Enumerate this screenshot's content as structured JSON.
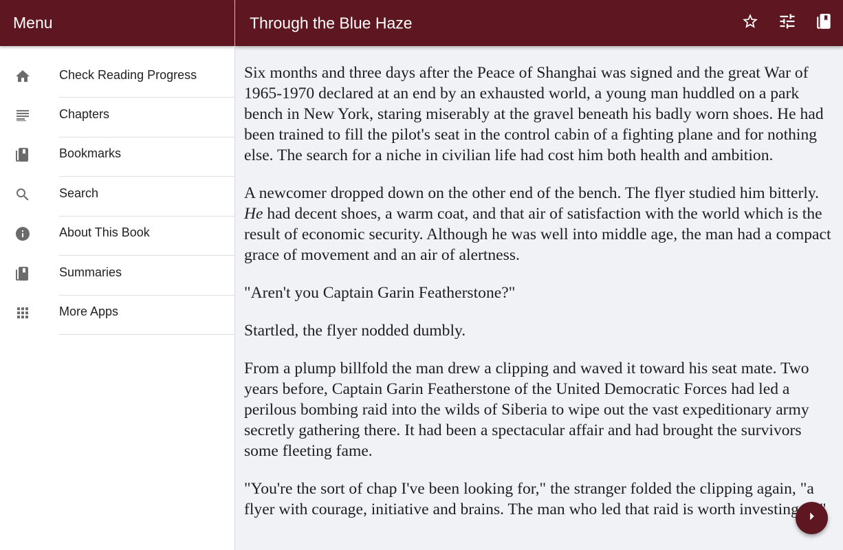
{
  "drawer": {
    "title": "Menu",
    "items": [
      {
        "label": "Check Reading Progress",
        "icon": "home-icon"
      },
      {
        "label": "Chapters",
        "icon": "list-icon"
      },
      {
        "label": "Bookmarks",
        "icon": "book-icon"
      },
      {
        "label": "Search",
        "icon": "search-icon"
      },
      {
        "label": "About This Book",
        "icon": "info-icon"
      },
      {
        "label": "Summaries",
        "icon": "book-icon"
      },
      {
        "label": "More Apps",
        "icon": "apps-grid-icon"
      }
    ]
  },
  "toolbar": {
    "title": "Through the Blue Haze",
    "actions": [
      "star-icon",
      "settings-sliders-icon",
      "book-icon"
    ]
  },
  "content": {
    "p1": "Six months and three days after the Peace of Shanghai was signed and the great War of 1965-1970 declared at an end by an exhausted world, a young man huddled on a park bench in New York, staring miserably at the gravel beneath his badly worn shoes. He had been trained to fill the pilot's seat in the control cabin of a fighting plane and for nothing else. The search for a niche in civilian life had cost him both health and ambition.",
    "p2_pre": "A newcomer dropped down on the other end of the bench. The flyer studied him bitterly. ",
    "p2_em": "He",
    "p2_post": " had decent shoes, a warm coat, and that air of satisfaction with the world which is the result of economic security. Although he was well into middle age, the man had a compact grace of movement and an air of alertness.",
    "p3": "\"Aren't you Captain Garin Featherstone?\"",
    "p4": "Startled, the flyer nodded dumbly.",
    "p5": "From a plump billfold the man drew a clipping and waved it toward his seat mate. Two years before, Captain Garin Featherstone of the United Democratic Forces had led a perilous bombing raid into the wilds of Siberia to wipe out the vast expeditionary army secretly gathering there. It had been a spectacular affair and had brought the survivors some fleeting fame.",
    "p6": "\"You're the sort of chap I've been looking for,\" the stranger folded the clipping again, \"a flyer with courage, initiative and brains. The man who led that raid is worth investing in.\""
  },
  "fab": {
    "icon": "chevron-right-icon"
  },
  "colors": {
    "primary": "#5e1720",
    "content_background": "#f1f2f6",
    "drawer_background": "#ffffff",
    "icon_gray": "#6b6b6b"
  }
}
